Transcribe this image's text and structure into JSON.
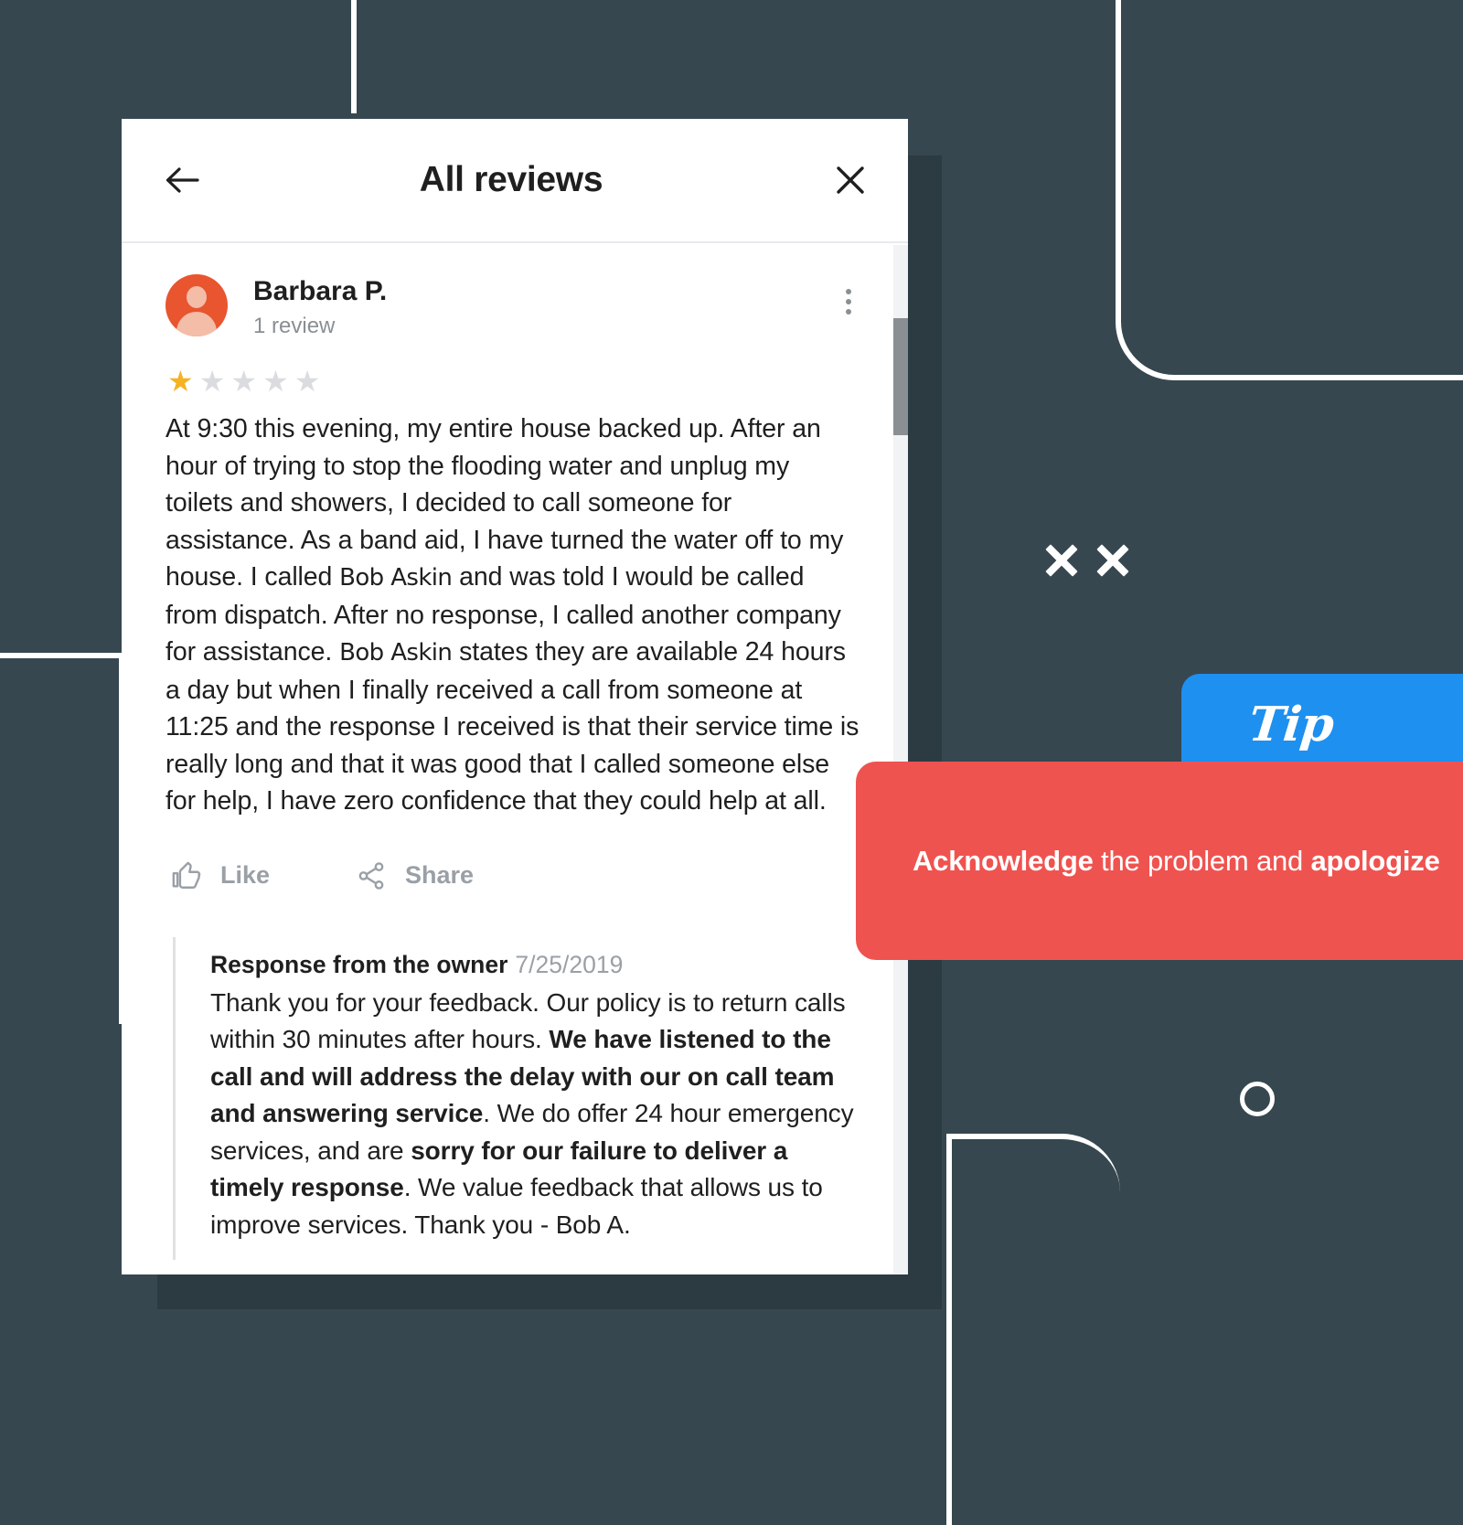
{
  "theme": {
    "background": "#36474f",
    "card_background": "#ffffff",
    "accent_blue": "#1e90f0",
    "accent_red": "#ef5350",
    "star_gold": "#f5b323",
    "star_grey": "#dadce0",
    "muted_text": "#9aa0a6",
    "avatar_orange": "#e8552f"
  },
  "dialog": {
    "title": "All reviews",
    "back_icon": "arrow-left-icon",
    "close_icon": "close-icon"
  },
  "review": {
    "reviewer_name": "Barbara P.",
    "reviewer_review_count": "1 review",
    "avatar_icon": "person-avatar-icon",
    "more_options_icon": "kebab-menu-icon",
    "rating": 1,
    "rating_max": 5,
    "star_filled_glyph": "★",
    "star_empty_glyph": "★",
    "body_parts": [
      {
        "text": "At 9:30 this evening, my entire house backed up. After an hour of trying to stop the flooding water and unplug my toilets and showers, I decided to call someone for assistance. As a band aid,  I have turned the water off to my house. I called ",
        "style": "normal"
      },
      {
        "text": "Bob Askin",
        "style": "entity"
      },
      {
        "text": " and was told I would be called from dispatch. After no response, I called another company for assistance. ",
        "style": "normal"
      },
      {
        "text": "Bob Askin",
        "style": "entity"
      },
      {
        "text": " states they are available 24 hours a day but when I finally received a call from someone at 11:25 and the response I received is that their service time is really long and that it was good that I called someone else for help, I have zero confidence that they could help at all.",
        "style": "normal"
      }
    ],
    "actions": [
      {
        "id": "like",
        "label": "Like",
        "icon": "thumbs-up-icon"
      },
      {
        "id": "share",
        "label": "Share",
        "icon": "share-icon"
      }
    ]
  },
  "owner_response": {
    "heading": "Response from the owner",
    "date": "7/25/2019",
    "body_parts": [
      {
        "text": "Thank you for your feedback. Our policy is to return calls within 30 minutes after hours. ",
        "style": "normal"
      },
      {
        "text": "We have listened to the call and will address the delay with our on call team and answering service",
        "style": "bold"
      },
      {
        "text": ". We do offer 24 hour emergency services, and are ",
        "style": "normal"
      },
      {
        "text": "sorry for our failure to deliver a timely response",
        "style": "bold"
      },
      {
        "text": ". We value feedback that allows us to improve services. Thank you - Bob A.",
        "style": "normal"
      }
    ]
  },
  "tip_badge": {
    "label": "Tip"
  },
  "callout": {
    "parts": [
      {
        "text": "Acknowledge",
        "style": "bold"
      },
      {
        "text": " the problem and ",
        "style": "normal"
      },
      {
        "text": "apologize",
        "style": "bold"
      }
    ]
  },
  "decorations": {
    "x_marks_icon": "x-mark-icon",
    "x_marks_count": 2,
    "circle_icon": "circle-outline-icon",
    "corner_lines": 4
  },
  "scrollbar": {
    "orientation": "vertical"
  }
}
